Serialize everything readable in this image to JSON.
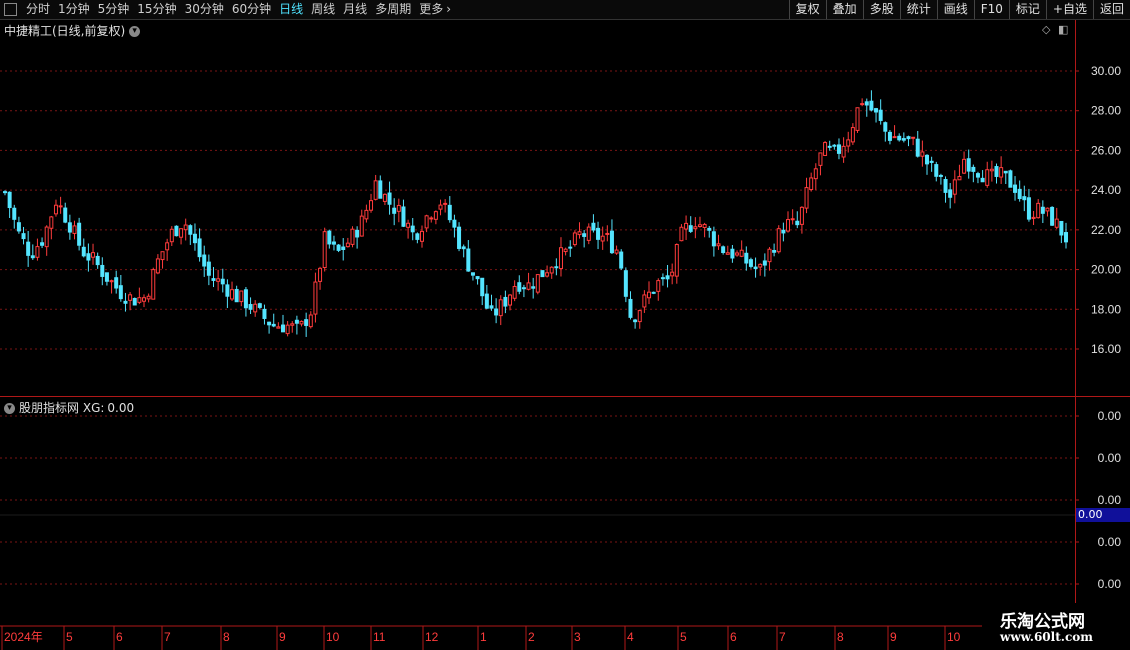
{
  "toolbar": {
    "periods": [
      "分时",
      "1分钟",
      "5分钟",
      "15分钟",
      "30分钟",
      "60分钟",
      "日线",
      "周线",
      "月线",
      "多周期",
      "更多"
    ],
    "active_period": "日线",
    "right_buttons": [
      "复权",
      "叠加",
      "多股",
      "统计",
      "画线",
      "F10",
      "标记",
      "+自选",
      "返回"
    ]
  },
  "price_panel": {
    "title": "中捷精工(日线,前复权)"
  },
  "indicator_panel": {
    "name": "股朋指标网",
    "series_label": "XG:",
    "series_value": "0.00",
    "current_tag": "0.00"
  },
  "watermark": {
    "line1": "乐淘公式网",
    "line2": "www.60lt.com"
  },
  "colors": {
    "up": "#ff3c3c",
    "down": "#54e5ff",
    "grid": "#7a1515",
    "axis": "#b01818",
    "axis_text": "#e0e0e0"
  },
  "chart_data": [
    {
      "type": "candlestick",
      "title": "中捷精工(日线,前复权)",
      "y_ticks": [
        16.0,
        18.0,
        20.0,
        22.0,
        24.0,
        26.0,
        28.0,
        30.0
      ],
      "ylim": [
        14.1,
        32.2
      ],
      "x_tick_labels": [
        "2024年",
        "5",
        "6",
        "7",
        "8",
        "9",
        "10",
        "11",
        "12",
        "1",
        "2",
        "3",
        "4",
        "5",
        "6",
        "7",
        "8",
        "9",
        "10"
      ],
      "grid": true,
      "series": [
        {
          "approx_close": [
            23.9,
            21.9,
            20.8,
            21.6,
            23.5,
            22.4,
            21.0,
            20.4,
            19.6,
            18.9,
            18.5,
            18.6,
            20.5,
            21.8,
            22.5,
            21.0,
            19.6,
            19.3,
            18.7,
            18.3,
            17.7,
            17.2,
            17.2,
            16.9,
            18.0,
            21.5,
            20.8,
            21.5,
            22.5,
            24.4,
            23.4,
            22.8,
            21.7,
            22.7,
            23.5,
            22.3,
            20.6,
            19.3,
            17.6,
            18.3,
            19.4,
            19.2,
            19.8,
            20.5,
            20.9,
            21.8,
            21.7,
            21.6,
            20.9,
            17.5,
            18.4,
            19.3,
            19.5,
            21.9,
            22.5,
            21.9,
            21.1,
            20.8,
            20.4,
            19.9,
            21.1,
            22.3,
            22.2,
            24.4,
            26.0,
            25.8,
            26.8,
            28.6,
            27.9,
            26.8,
            26.6,
            26.4,
            25.5,
            24.6,
            23.6,
            25.6,
            25.1,
            24.6,
            24.7,
            24.2,
            22.9,
            23.0,
            22.5,
            21.6
          ]
        }
      ]
    },
    {
      "type": "line",
      "series": [
        {
          "name": "XG",
          "values": [
            0.0
          ]
        }
      ],
      "y_ticks": [
        0.0,
        0.0,
        0.0,
        0.0,
        0.0
      ]
    }
  ]
}
